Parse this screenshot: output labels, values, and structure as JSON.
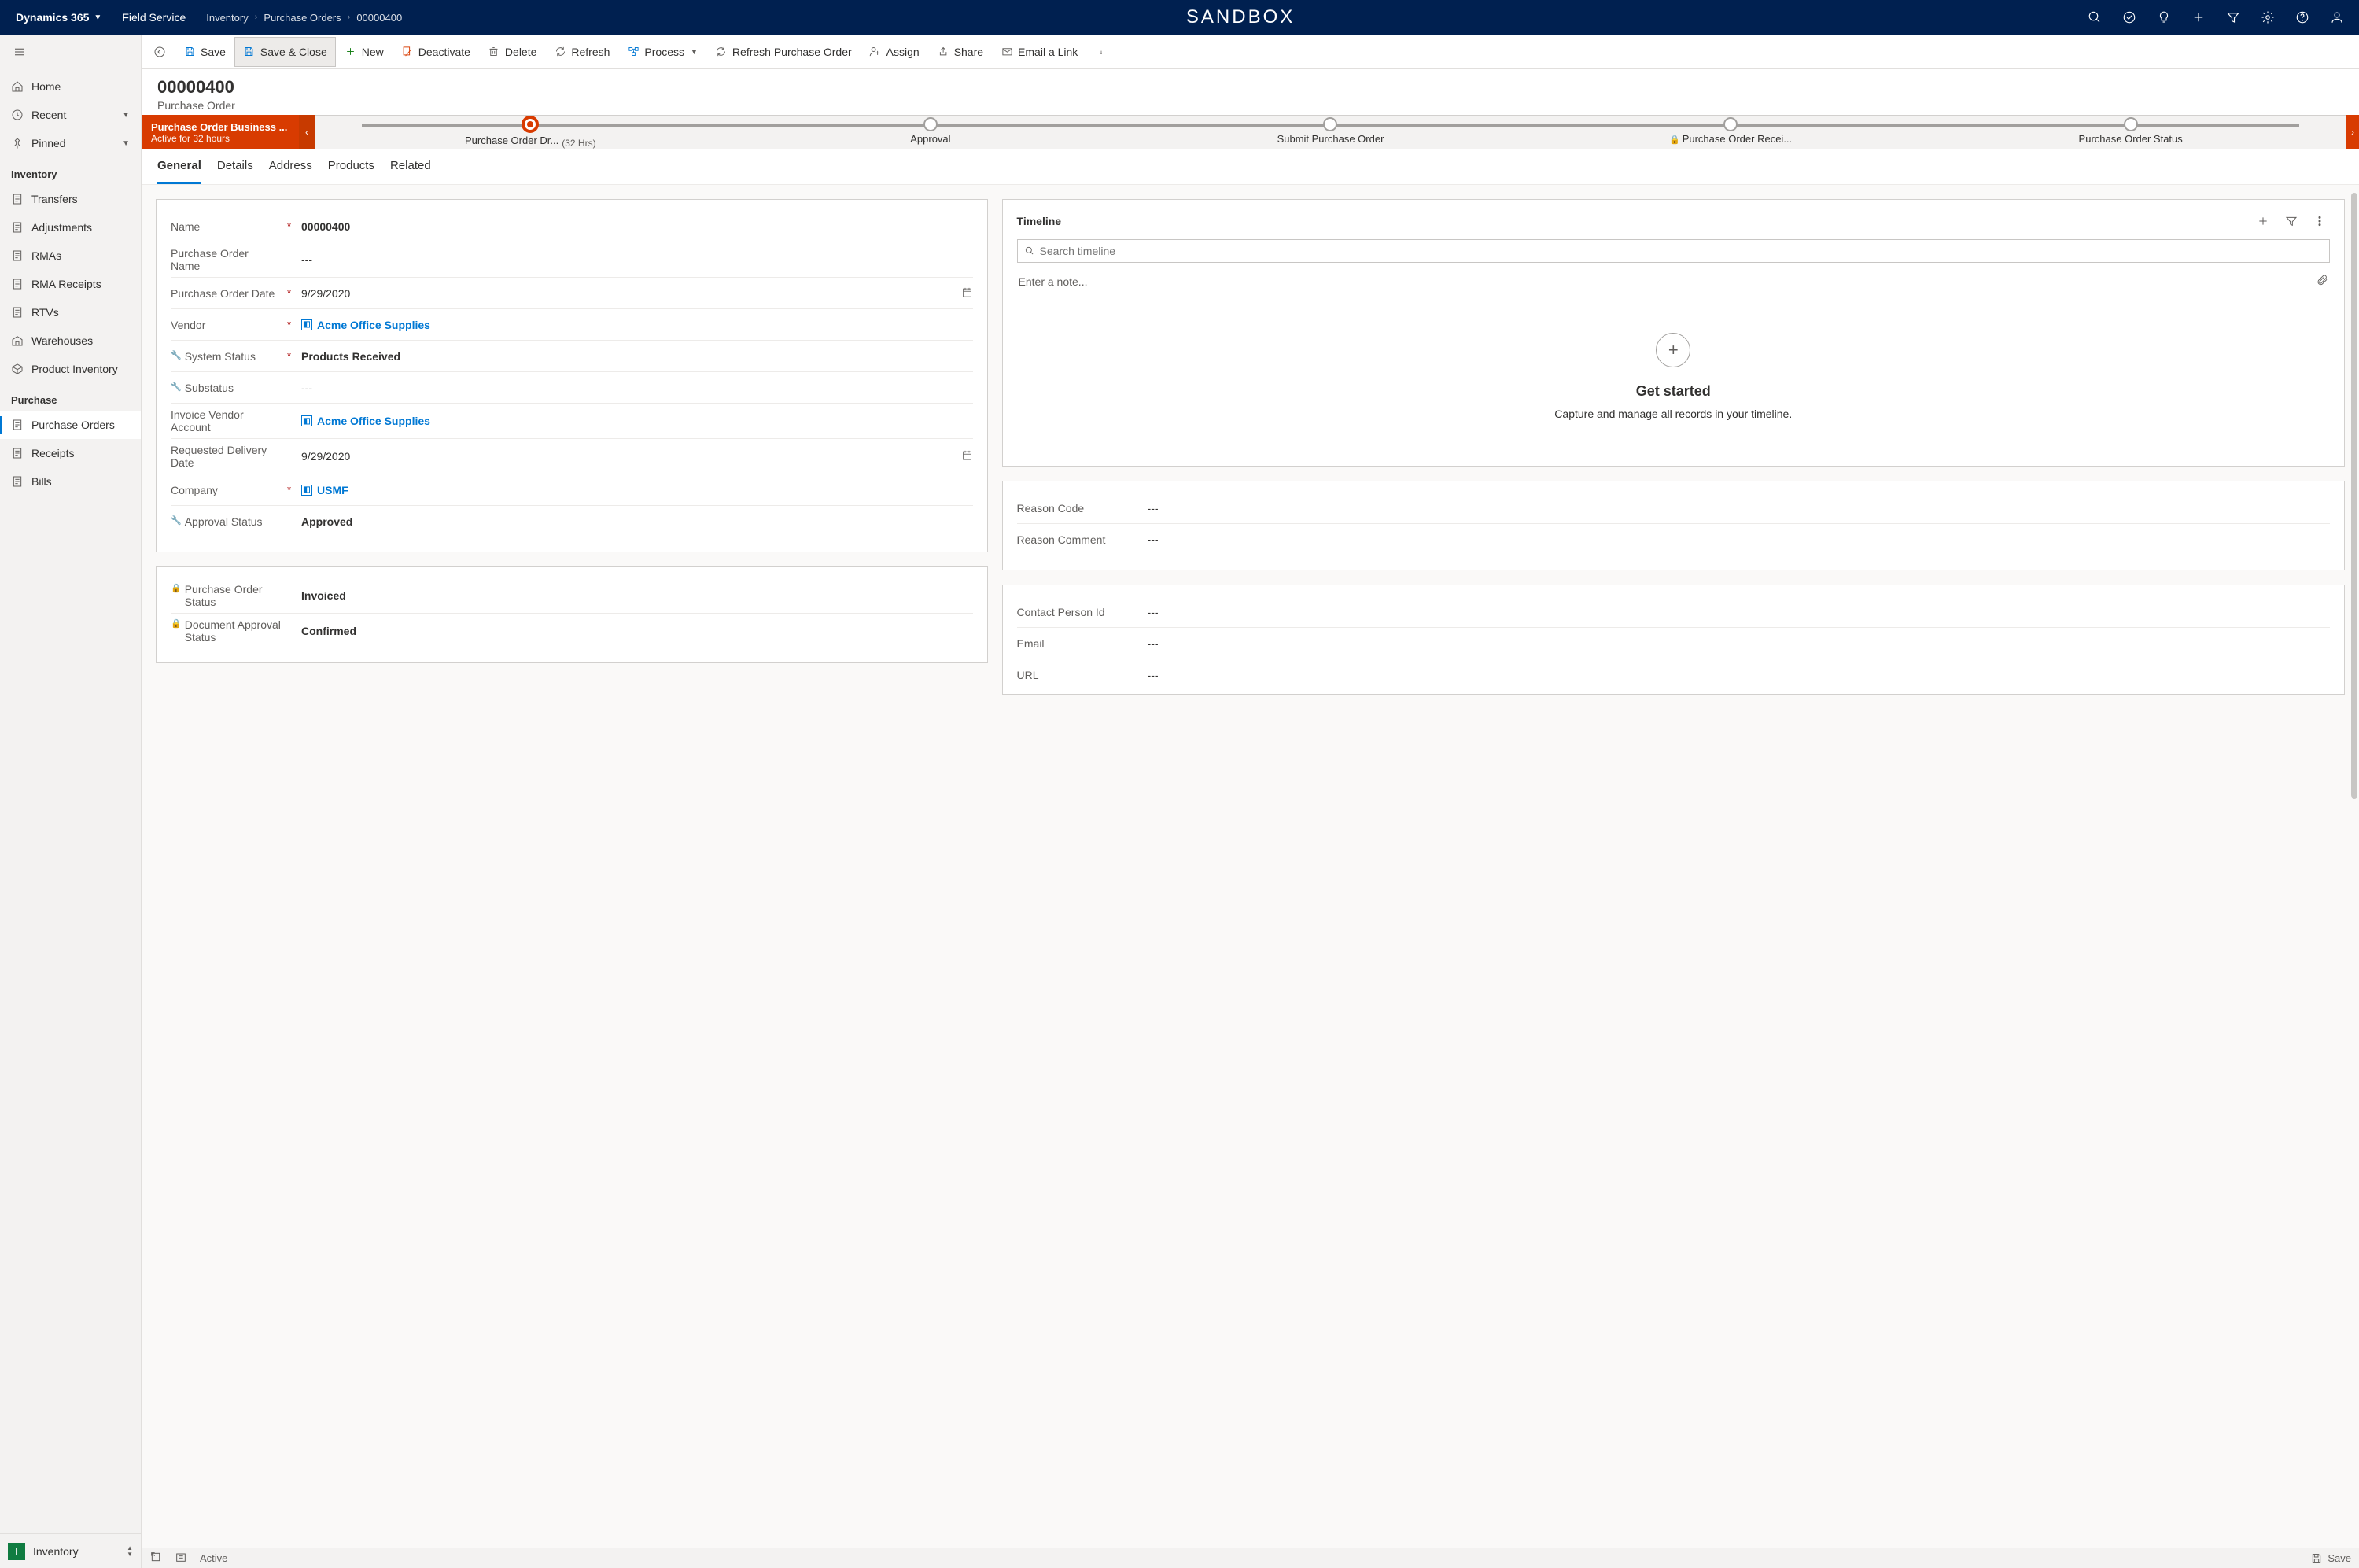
{
  "header": {
    "app": "Dynamics 365",
    "product": "Field Service",
    "breadcrumbs": [
      "Inventory",
      "Purchase Orders",
      "00000400"
    ],
    "center": "SANDBOX"
  },
  "nav": {
    "top": [
      {
        "label": "Home",
        "icon": "home"
      },
      {
        "label": "Recent",
        "icon": "clock",
        "expandable": true
      },
      {
        "label": "Pinned",
        "icon": "pin",
        "expandable": true
      }
    ],
    "sections": [
      {
        "header": "Inventory",
        "items": [
          {
            "label": "Transfers",
            "icon": "doc"
          },
          {
            "label": "Adjustments",
            "icon": "doc"
          },
          {
            "label": "RMAs",
            "icon": "doc"
          },
          {
            "label": "RMA Receipts",
            "icon": "doc"
          },
          {
            "label": "RTVs",
            "icon": "doc"
          },
          {
            "label": "Warehouses",
            "icon": "warehouse"
          },
          {
            "label": "Product Inventory",
            "icon": "box"
          }
        ]
      },
      {
        "header": "Purchase",
        "items": [
          {
            "label": "Purchase Orders",
            "icon": "doc",
            "active": true
          },
          {
            "label": "Receipts",
            "icon": "doc"
          },
          {
            "label": "Bills",
            "icon": "doc"
          }
        ]
      }
    ],
    "area": {
      "badge": "I",
      "label": "Inventory"
    }
  },
  "commands": [
    {
      "id": "save",
      "label": "Save",
      "icon": "save",
      "color": "#0078d4"
    },
    {
      "id": "save-close",
      "label": "Save & Close",
      "icon": "save",
      "color": "#0078d4",
      "highlighted": true
    },
    {
      "id": "new",
      "label": "New",
      "icon": "plus",
      "color": "#107c10"
    },
    {
      "id": "deactivate",
      "label": "Deactivate",
      "icon": "deactivate",
      "color": "#d83b01"
    },
    {
      "id": "delete",
      "label": "Delete",
      "icon": "trash",
      "color": "#605e5c"
    },
    {
      "id": "refresh",
      "label": "Refresh",
      "icon": "refresh",
      "color": "#605e5c"
    },
    {
      "id": "process",
      "label": "Process",
      "icon": "flow",
      "color": "#0078d4",
      "dropdown": true
    },
    {
      "id": "refresh-po",
      "label": "Refresh Purchase Order",
      "icon": "refresh",
      "color": "#605e5c"
    },
    {
      "id": "assign",
      "label": "Assign",
      "icon": "assign",
      "color": "#605e5c"
    },
    {
      "id": "share",
      "label": "Share",
      "icon": "share",
      "color": "#605e5c"
    },
    {
      "id": "email-link",
      "label": "Email a Link",
      "icon": "mail",
      "color": "#605e5c"
    }
  ],
  "record": {
    "id": "00000400",
    "type": "Purchase Order"
  },
  "process": {
    "title": "Purchase Order Business ...",
    "subtitle": "Active for 32 hours",
    "stages": [
      {
        "label": "Purchase Order Dr...",
        "active": true,
        "time": "(32 Hrs)"
      },
      {
        "label": "Approval"
      },
      {
        "label": "Submit Purchase Order"
      },
      {
        "label": "Purchase Order Recei...",
        "locked": true
      },
      {
        "label": "Purchase Order Status"
      }
    ]
  },
  "tabs": [
    "General",
    "Details",
    "Address",
    "Products",
    "Related"
  ],
  "active_tab": "General",
  "form": {
    "main": [
      {
        "label": "Name",
        "value": "00000400",
        "required": true,
        "bold": true
      },
      {
        "label": "Purchase Order Name",
        "value": "---"
      },
      {
        "label": "Purchase Order Date",
        "value": "9/29/2020",
        "required": true,
        "calendar": true
      },
      {
        "label": "Vendor",
        "value": "Acme Office Supplies",
        "required": true,
        "link": true,
        "lookup": true
      },
      {
        "label": "System Status",
        "value": "Products Received",
        "required": true,
        "wrench": true,
        "bold": true
      },
      {
        "label": "Substatus",
        "value": "---",
        "wrench": true
      },
      {
        "label": "Invoice Vendor Account",
        "value": "Acme Office Supplies",
        "link": true,
        "lookup": true
      },
      {
        "label": "Requested Delivery Date",
        "value": "9/29/2020",
        "calendar": true
      },
      {
        "label": "Company",
        "value": "USMF",
        "required": true,
        "link": true,
        "lookup": true
      },
      {
        "label": "Approval Status",
        "value": "Approved",
        "wrench": true,
        "bold": true
      }
    ],
    "status": [
      {
        "label": "Purchase Order Status",
        "value": "Invoiced",
        "locked": true,
        "bold": true
      },
      {
        "label": "Document Approval Status",
        "value": "Confirmed",
        "locked": true,
        "bold": true
      }
    ],
    "reason": [
      {
        "label": "Reason Code",
        "value": "---"
      },
      {
        "label": "Reason Comment",
        "value": "---"
      }
    ],
    "contact": [
      {
        "label": "Contact Person Id",
        "value": "---"
      },
      {
        "label": "Email",
        "value": "---"
      },
      {
        "label": "URL",
        "value": "---"
      }
    ]
  },
  "timeline": {
    "title": "Timeline",
    "search_placeholder": "Search timeline",
    "note_placeholder": "Enter a note...",
    "empty_title": "Get started",
    "empty_text": "Capture and manage all records in your timeline."
  },
  "footer": {
    "status": "Active",
    "save": "Save"
  }
}
